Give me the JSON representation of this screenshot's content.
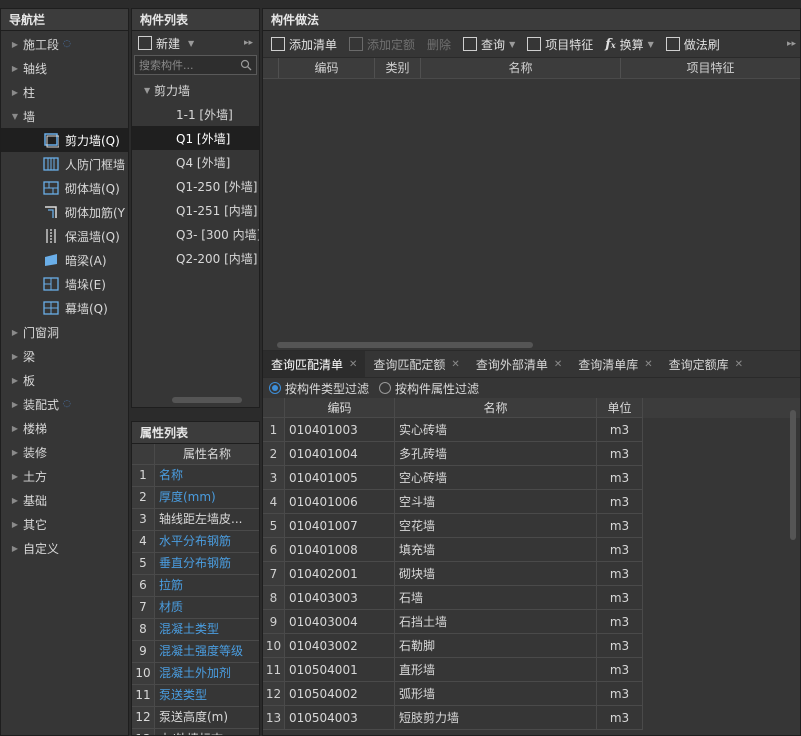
{
  "nav": {
    "title": "导航栏",
    "items": [
      {
        "label": "施工段",
        "expanded": false,
        "marker": true
      },
      {
        "label": "轴线",
        "expanded": false
      },
      {
        "label": "柱",
        "expanded": false
      },
      {
        "label": "墙",
        "expanded": true
      },
      {
        "label": "门窗洞",
        "expanded": false
      },
      {
        "label": "梁",
        "expanded": false
      },
      {
        "label": "板",
        "expanded": false
      },
      {
        "label": "装配式",
        "expanded": false,
        "marker": true
      },
      {
        "label": "楼梯",
        "expanded": false
      },
      {
        "label": "装修",
        "expanded": false
      },
      {
        "label": "土方",
        "expanded": false
      },
      {
        "label": "基础",
        "expanded": false
      },
      {
        "label": "其它",
        "expanded": false
      },
      {
        "label": "自定义",
        "expanded": false
      }
    ],
    "wall_children": [
      {
        "label": "剪力墙(Q)",
        "icon": "shear-wall-icon",
        "selected": true
      },
      {
        "label": "人防门框墙",
        "icon": "civil-defense-wall-icon"
      },
      {
        "label": "砌体墙(Q)",
        "icon": "masonry-wall-icon"
      },
      {
        "label": "砌体加筋(Y",
        "icon": "masonry-reinforcement-icon"
      },
      {
        "label": "保温墙(Q)",
        "icon": "insulation-wall-icon"
      },
      {
        "label": "暗梁(A)",
        "icon": "hidden-beam-icon"
      },
      {
        "label": "墙垛(E)",
        "icon": "wall-pier-icon"
      },
      {
        "label": "幕墙(Q)",
        "icon": "curtain-wall-icon"
      }
    ]
  },
  "component_list": {
    "title": "构件列表",
    "new_label": "新建",
    "search_placeholder": "搜索构件...",
    "group": "剪力墙",
    "items": [
      {
        "label": "1-1 [外墙]"
      },
      {
        "label": "Q1 [外墙]",
        "selected": true
      },
      {
        "label": "Q4 [外墙]"
      },
      {
        "label": "Q1-250 [外墙]"
      },
      {
        "label": "Q1-251 [内墙]"
      },
      {
        "label": "Q3- [300 内墙]"
      },
      {
        "label": "Q2-200 [内墙]"
      }
    ]
  },
  "props": {
    "title": "属性列表",
    "header": "属性名称",
    "rows": [
      {
        "n": "1",
        "label": "名称",
        "blue": true
      },
      {
        "n": "2",
        "label": "厚度(mm)",
        "blue": true
      },
      {
        "n": "3",
        "label": "轴线距左墙皮...",
        "blue": false
      },
      {
        "n": "4",
        "label": "水平分布钢筋",
        "blue": true
      },
      {
        "n": "5",
        "label": "垂直分布钢筋",
        "blue": true
      },
      {
        "n": "6",
        "label": "拉筋",
        "blue": true
      },
      {
        "n": "7",
        "label": "材质",
        "blue": true
      },
      {
        "n": "8",
        "label": "混凝土类型",
        "blue": true
      },
      {
        "n": "9",
        "label": "混凝土强度等级",
        "blue": true
      },
      {
        "n": "10",
        "label": "混凝土外加剂",
        "blue": true
      },
      {
        "n": "11",
        "label": "泵送类型",
        "blue": true
      },
      {
        "n": "12",
        "label": "泵送高度(m)",
        "blue": false
      },
      {
        "n": "13",
        "label": "内/外墙标志",
        "blue": false
      }
    ]
  },
  "method": {
    "title": "构件做法",
    "toolbar": {
      "add_list": "添加清单",
      "add_quota": "添加定额",
      "delete": "删除",
      "query": "查询",
      "item_feature": "项目特征",
      "convert": "换算",
      "method_brush": "做法刷"
    },
    "columns": {
      "code": "编码",
      "type": "类别",
      "name": "名称",
      "feature": "项目特征"
    }
  },
  "query": {
    "tabs": [
      "查询匹配清单",
      "查询匹配定额",
      "查询外部清单",
      "查询清单库",
      "查询定额库"
    ],
    "filter_type": "按构件类型过滤",
    "filter_attr": "按构件属性过滤",
    "columns": {
      "code": "编码",
      "name": "名称",
      "unit": "单位"
    },
    "rows": [
      {
        "n": "1",
        "code": "010401003",
        "name": "实心砖墙",
        "unit": "m3"
      },
      {
        "n": "2",
        "code": "010401004",
        "name": "多孔砖墙",
        "unit": "m3"
      },
      {
        "n": "3",
        "code": "010401005",
        "name": "空心砖墙",
        "unit": "m3"
      },
      {
        "n": "4",
        "code": "010401006",
        "name": "空斗墙",
        "unit": "m3"
      },
      {
        "n": "5",
        "code": "010401007",
        "name": "空花墙",
        "unit": "m3"
      },
      {
        "n": "6",
        "code": "010401008",
        "name": "填充墙",
        "unit": "m3"
      },
      {
        "n": "7",
        "code": "010402001",
        "name": "砌块墙",
        "unit": "m3"
      },
      {
        "n": "8",
        "code": "010403003",
        "name": "石墙",
        "unit": "m3"
      },
      {
        "n": "9",
        "code": "010403004",
        "name": "石挡土墙",
        "unit": "m3"
      },
      {
        "n": "10",
        "code": "010403002",
        "name": "石勒脚",
        "unit": "m3"
      },
      {
        "n": "11",
        "code": "010504001",
        "name": "直形墙",
        "unit": "m3"
      },
      {
        "n": "12",
        "code": "010504002",
        "name": "弧形墙",
        "unit": "m3"
      },
      {
        "n": "13",
        "code": "010504003",
        "name": "短肢剪力墙",
        "unit": "m3"
      }
    ]
  },
  "colors": {
    "accent": "#3d8ed8",
    "link_blue": "#4a9de0",
    "panel": "#363636",
    "header": "#3c3c3c"
  }
}
